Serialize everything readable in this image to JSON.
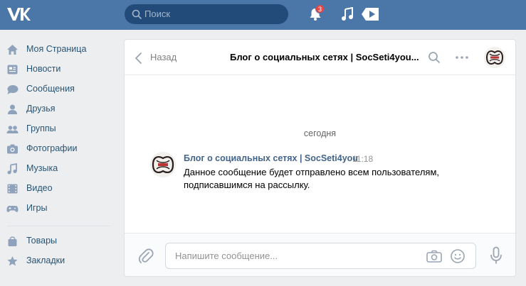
{
  "colors": {
    "topbar": "#4a76a8",
    "link": "#285473",
    "author": "#42648b",
    "badge": "#e64646",
    "background": "#edeef0"
  },
  "topbar": {
    "logo": "vk-logo",
    "search_placeholder": "Поиск",
    "notifications_count": "3",
    "icons": [
      "search-icon",
      "bell-icon",
      "music-icon",
      "play-icon"
    ]
  },
  "sidebar": {
    "items": [
      {
        "label": "Моя Страница",
        "icon": "home-icon"
      },
      {
        "label": "Новости",
        "icon": "news-icon"
      },
      {
        "label": "Сообщения",
        "icon": "messages-icon"
      },
      {
        "label": "Друзья",
        "icon": "friend-icon"
      },
      {
        "label": "Группы",
        "icon": "groups-icon"
      },
      {
        "label": "Фотографии",
        "icon": "camera-icon"
      },
      {
        "label": "Музыка",
        "icon": "music-icon"
      },
      {
        "label": "Видео",
        "icon": "video-icon"
      },
      {
        "label": "Игры",
        "icon": "gamepad-icon"
      },
      {
        "label": "Товары",
        "icon": "bag-icon"
      },
      {
        "label": "Закладки",
        "icon": "star-icon"
      }
    ]
  },
  "chat": {
    "back_label": "Назад",
    "title": "Блог о социальных сетях | SocSeti4you...",
    "date_separator": "сегодня",
    "message": {
      "author": "Блог о социальных сетях | SocSeti4you",
      "time": "11:18",
      "text": "Данное сообщение будет отправлено всем пользователям, подписавшимся на рассылку."
    },
    "composer_placeholder": "Напишите сообщение..."
  }
}
